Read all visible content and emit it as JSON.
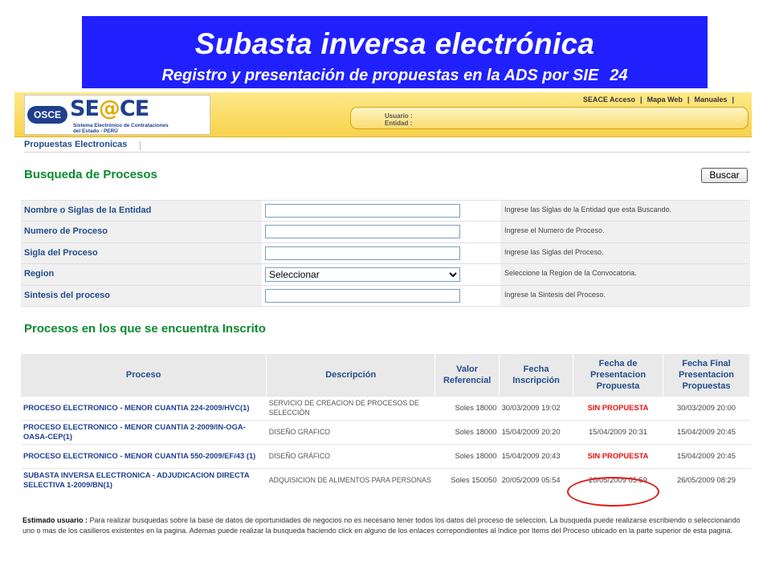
{
  "slide": {
    "title": "Subasta inversa electrónica",
    "subtitle": "Registro y presentación de propuestas en la ADS por SIE",
    "page_number": "24"
  },
  "header": {
    "logo_osce": "OSCE",
    "logo_brand_pre": "SE",
    "logo_brand_at": "@",
    "logo_brand_post": "CE",
    "logo_sub1": "Sistema Electrónico de Contrataciones",
    "logo_sub2": "del Estado - PERÚ",
    "links": [
      "SEACE Acceso",
      "Mapa Web",
      "Manuales"
    ],
    "user_label": "Usuario :",
    "entity_label": "Entidad :"
  },
  "nav": {
    "tab": "Propuestas Electronicas"
  },
  "search": {
    "title": "Busqueda de Procesos",
    "button": "Buscar",
    "fields": [
      {
        "label": "Nombre o Siglas de la Entidad",
        "value": "",
        "hint": "Ingrese las Siglas de la Entidad que esta Buscando."
      },
      {
        "label": "Numero de Proceso",
        "value": "",
        "hint": "Ingrese el Numero de Proceso."
      },
      {
        "label": "Sigla del Proceso",
        "value": "",
        "hint": "Ingrese las Siglas del Proceso."
      },
      {
        "label": "Region",
        "value": "Seleccionar",
        "hint": "Seleccione la Region de la Convocatoria."
      },
      {
        "label": "Sintesis del proceso",
        "value": "",
        "hint": "Ingrese la Sintesis del Proceso."
      }
    ]
  },
  "results": {
    "title": "Procesos en los que se encuentra Inscrito",
    "columns": [
      "Proceso",
      "Descripción",
      "Valor Referencial",
      "Fecha Inscripción",
      "Fecha de Presentacion Propuesta",
      "Fecha Final Presentacion Propuestas"
    ],
    "rows": [
      {
        "proceso": "PROCESO ELECTRONICO - MENOR CUANTIA 224-2009/HVC(1)",
        "descripcion": "SERVICIO DE CREACION DE PROCESOS DE SELECCIÓN",
        "valor": "Soles 18000",
        "inscripcion": "30/03/2009 19:02",
        "presentacion": "SIN PROPUESTA",
        "final": "30/03/2009 20:00"
      },
      {
        "proceso": "PROCESO ELECTRONICO - MENOR CUANTIA 2-2009/IN-OGA-OASA-CEP(1)",
        "descripcion": "DISEÑO GRAFICO",
        "valor": "Soles 18000",
        "inscripcion": "15/04/2009 20:20",
        "presentacion": "15/04/2009 20:31",
        "final": "15/04/2009 20:45"
      },
      {
        "proceso": "PROCESO ELECTRONICO - MENOR CUANTIA 550-2009/EF/43 (1)",
        "descripcion": "DISEÑO GRÁFICO",
        "valor": "Soles 18000",
        "inscripcion": "15/04/2009 20:43",
        "presentacion": "SIN PROPUESTA",
        "final": "15/04/2009 20:45"
      },
      {
        "proceso": "SUBASTA INVERSA ELECTRONICA - ADJUDICACION DIRECTA SELECTIVA 1-2009/BN(1)",
        "descripcion": "ADQUISICION DE ALIMENTOS PARA PERSONAS",
        "valor": "Soles 150050",
        "inscripcion": "20/05/2009 05:54",
        "presentacion": "20/05/2009 05:59",
        "final": "26/05/2009 08:29"
      }
    ]
  },
  "note": {
    "lead": "Estimado usuario :",
    "text": "Para realizar busquedas sobre la base de datos de oportunidades de negocios no es necesario tener todos los datos del proceso de seleccion. La busqueda puede realizarse escribiendo o seleccionando uno o mas de los casilleros existentes en la pagina. Ademas puede realizar la busqueda haciendo click en alguno de los enlaces correpondientes al Indice por Items del Proceso ubicado en la parte superior de esta pagina."
  },
  "colors": {
    "banner": "#2020ff",
    "section_title": "#0b8a2f",
    "link": "#234d8c",
    "alert": "#e11111"
  }
}
